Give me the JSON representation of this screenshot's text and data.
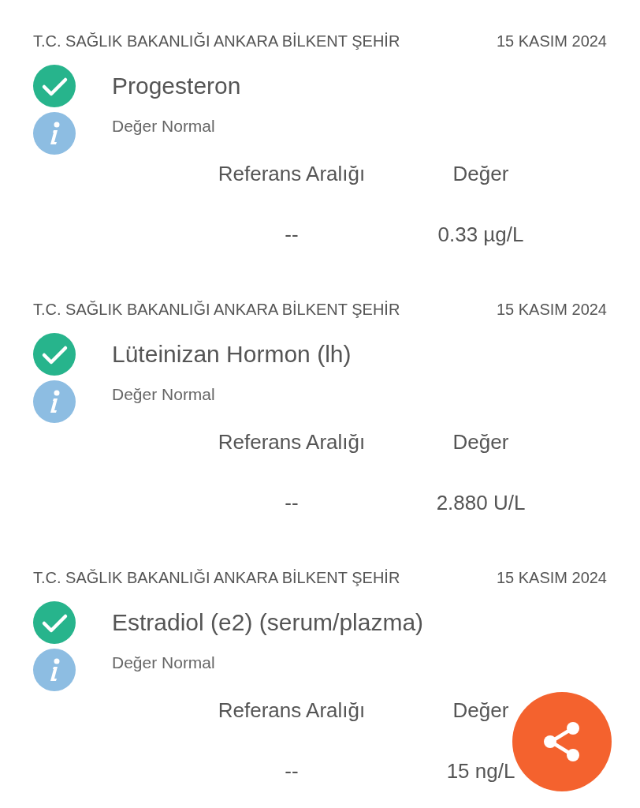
{
  "results": [
    {
      "facility": "T.C. SAĞLIK BAKANLIĞI ANKARA BİLKENT ŞEHİR",
      "date": "15 KASIM 2024",
      "normal": true,
      "title": "Progesteron",
      "note": "Değer Normal",
      "reference_label": "Referans Aralığı",
      "value_label": "Değer",
      "reference": "--",
      "value": "0.33 µg/L"
    },
    {
      "facility": "T.C. SAĞLIK BAKANLIĞI ANKARA BİLKENT ŞEHİR",
      "date": "15 KASIM 2024",
      "normal": true,
      "title": "Lüteinizan Hormon (lh)",
      "note": "Değer Normal",
      "reference_label": "Referans Aralığı",
      "value_label": "Değer",
      "reference": "--",
      "value": "2.880 U/L"
    },
    {
      "facility": "T.C. SAĞLIK BAKANLIĞI ANKARA BİLKENT ŞEHİR",
      "date": "15 KASIM 2024",
      "normal": true,
      "title": "Estradiol (e2) (serum/plazma)",
      "note": "Değer Normal",
      "reference_label": "Referans Aralığı",
      "value_label": "Değer",
      "reference": "--",
      "value": "15 ng/L"
    }
  ]
}
